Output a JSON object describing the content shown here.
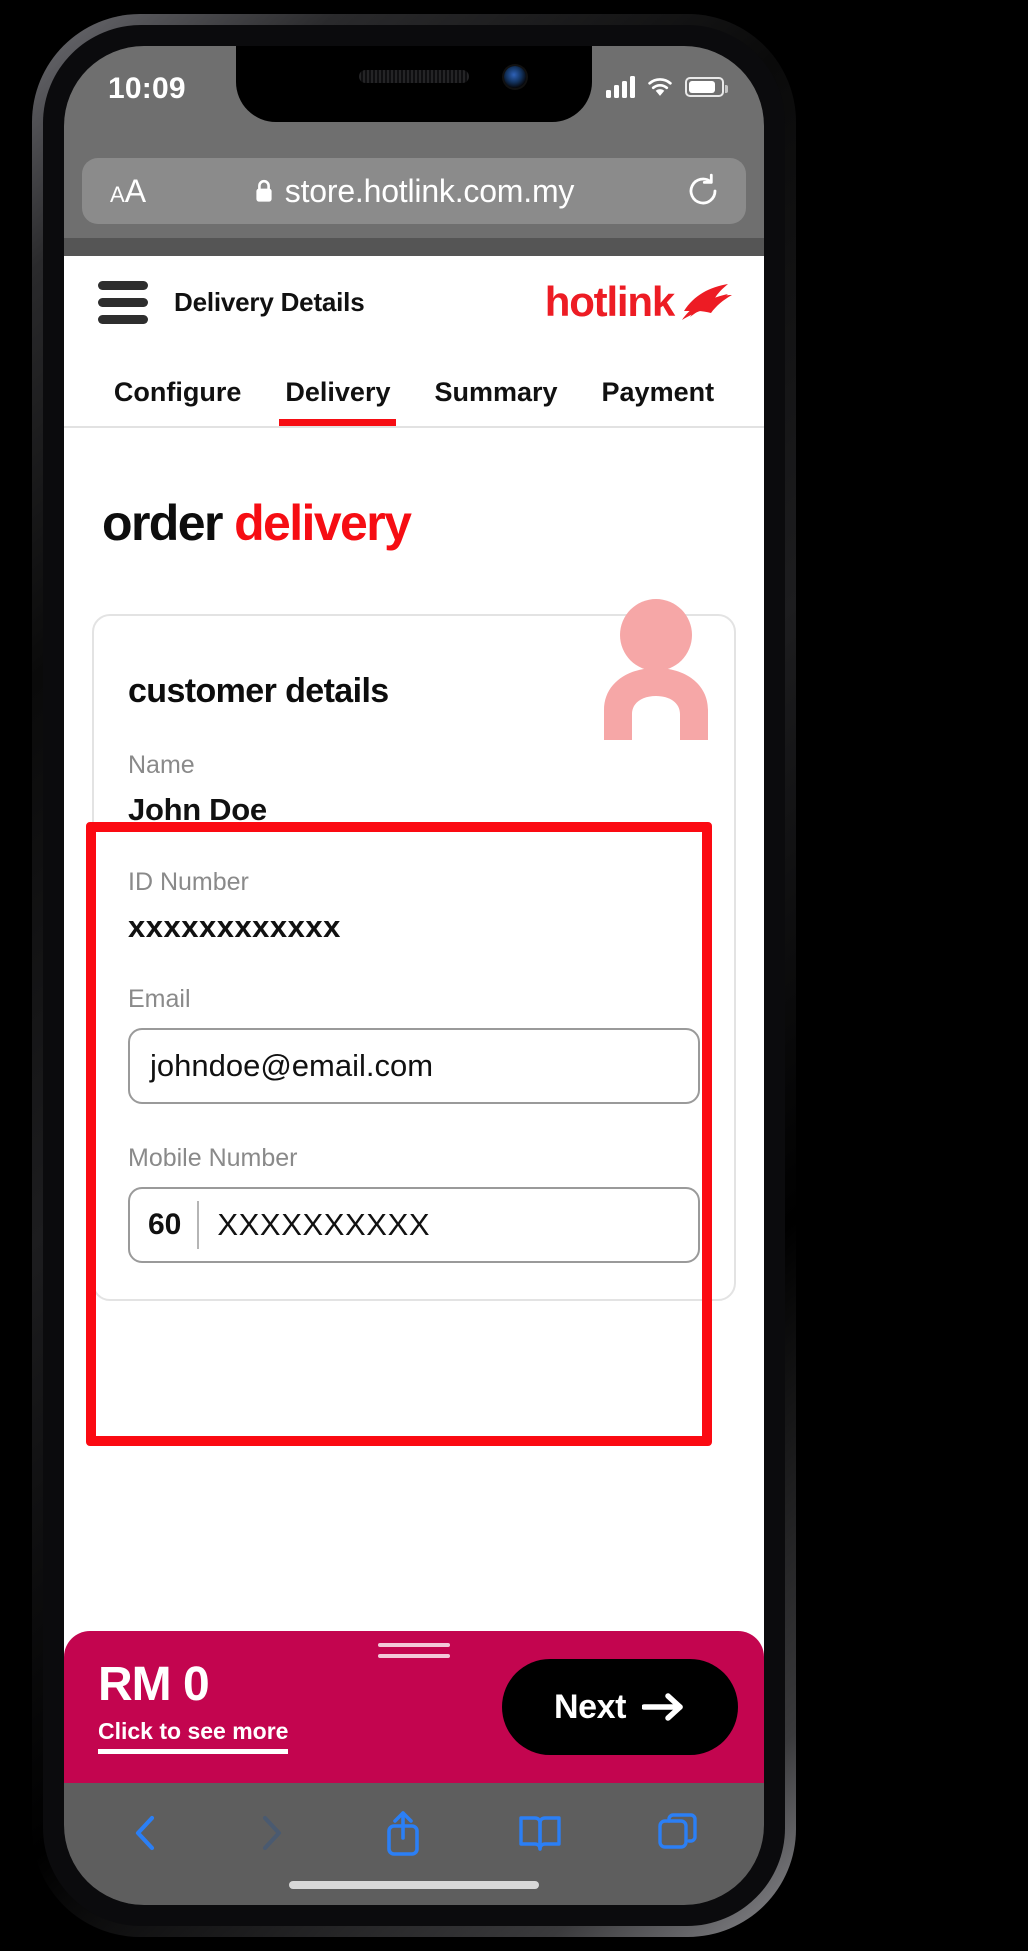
{
  "status_bar": {
    "time": "10:09",
    "signal_icon": "cellular-signal-icon",
    "wifi_icon": "wifi-icon",
    "battery_icon": "battery-icon"
  },
  "browser": {
    "aa_button_small": "A",
    "aa_button_big": "A",
    "lock_icon": "lock-icon",
    "url": "store.hotlink.com.my",
    "reload_icon": "reload-icon",
    "toolbar": {
      "back_icon": "chevron-left-icon",
      "forward_icon": "chevron-right-icon",
      "share_icon": "share-icon",
      "bookmarks_icon": "book-icon",
      "tabs_icon": "tabs-icon"
    }
  },
  "site_header": {
    "menu_icon": "hamburger-menu-icon",
    "title": "Delivery Details",
    "brand_name": "hotlink",
    "brand_mark_icon": "hotlink-swoosh-icon",
    "brand_color": "#ed1c24"
  },
  "tabs": [
    {
      "label": "Configure",
      "active": false
    },
    {
      "label": "Delivery",
      "active": true
    },
    {
      "label": "Summary",
      "active": false
    },
    {
      "label": "Payment",
      "active": false
    }
  ],
  "heading": {
    "part1": "order",
    "part2": "delivery",
    "part2_color": "#f60d13"
  },
  "customer_card": {
    "title": "customer details",
    "avatar_icon": "person-avatar-icon",
    "fields": [
      {
        "label": "Name",
        "value": "John Doe",
        "type": "static"
      },
      {
        "label": "ID Number",
        "value": "xxxxxxxxxxxx",
        "type": "static"
      },
      {
        "label": "Email",
        "value": "johndoe@email.com",
        "type": "input"
      },
      {
        "label": "Mobile Number",
        "prefix": "60",
        "value": "XXXXXXXXXX",
        "type": "phone"
      }
    ]
  },
  "annotation": {
    "highlight_color": "#fb0a12"
  },
  "price_bar": {
    "amount": "RM 0",
    "see_more": "Click to see more",
    "next_label": "Next",
    "next_arrow_icon": "arrow-right-icon",
    "drag_handle_icon": "drag-handle-icon",
    "background_color": "#c3054f"
  }
}
